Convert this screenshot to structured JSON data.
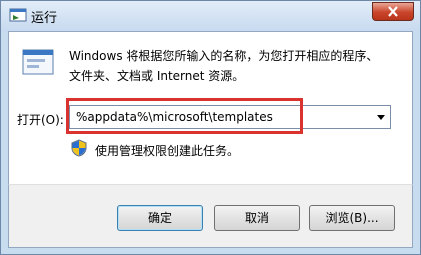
{
  "window": {
    "title": "运行",
    "icon": "run-icon",
    "close_icon": "close-icon"
  },
  "description": {
    "line1": "Windows 将根据您所输入的名称，为您打开相应的程序、",
    "line2": "文件夹、文档或 Internet 资源。"
  },
  "open_field": {
    "label": "打开(O):",
    "value": "%appdata%\\microsoft\\templates",
    "dropdown_icon": "chevron-down-icon"
  },
  "admin_notice": {
    "text": "使用管理权限创建此任务。",
    "icon": "uac-shield-icon"
  },
  "buttons": {
    "ok": "确定",
    "cancel": "取消",
    "browse": "浏览(B)..."
  },
  "colors": {
    "highlight": "#d9322f",
    "close_button": "#c9442a",
    "frame": "#c8dcf0"
  }
}
